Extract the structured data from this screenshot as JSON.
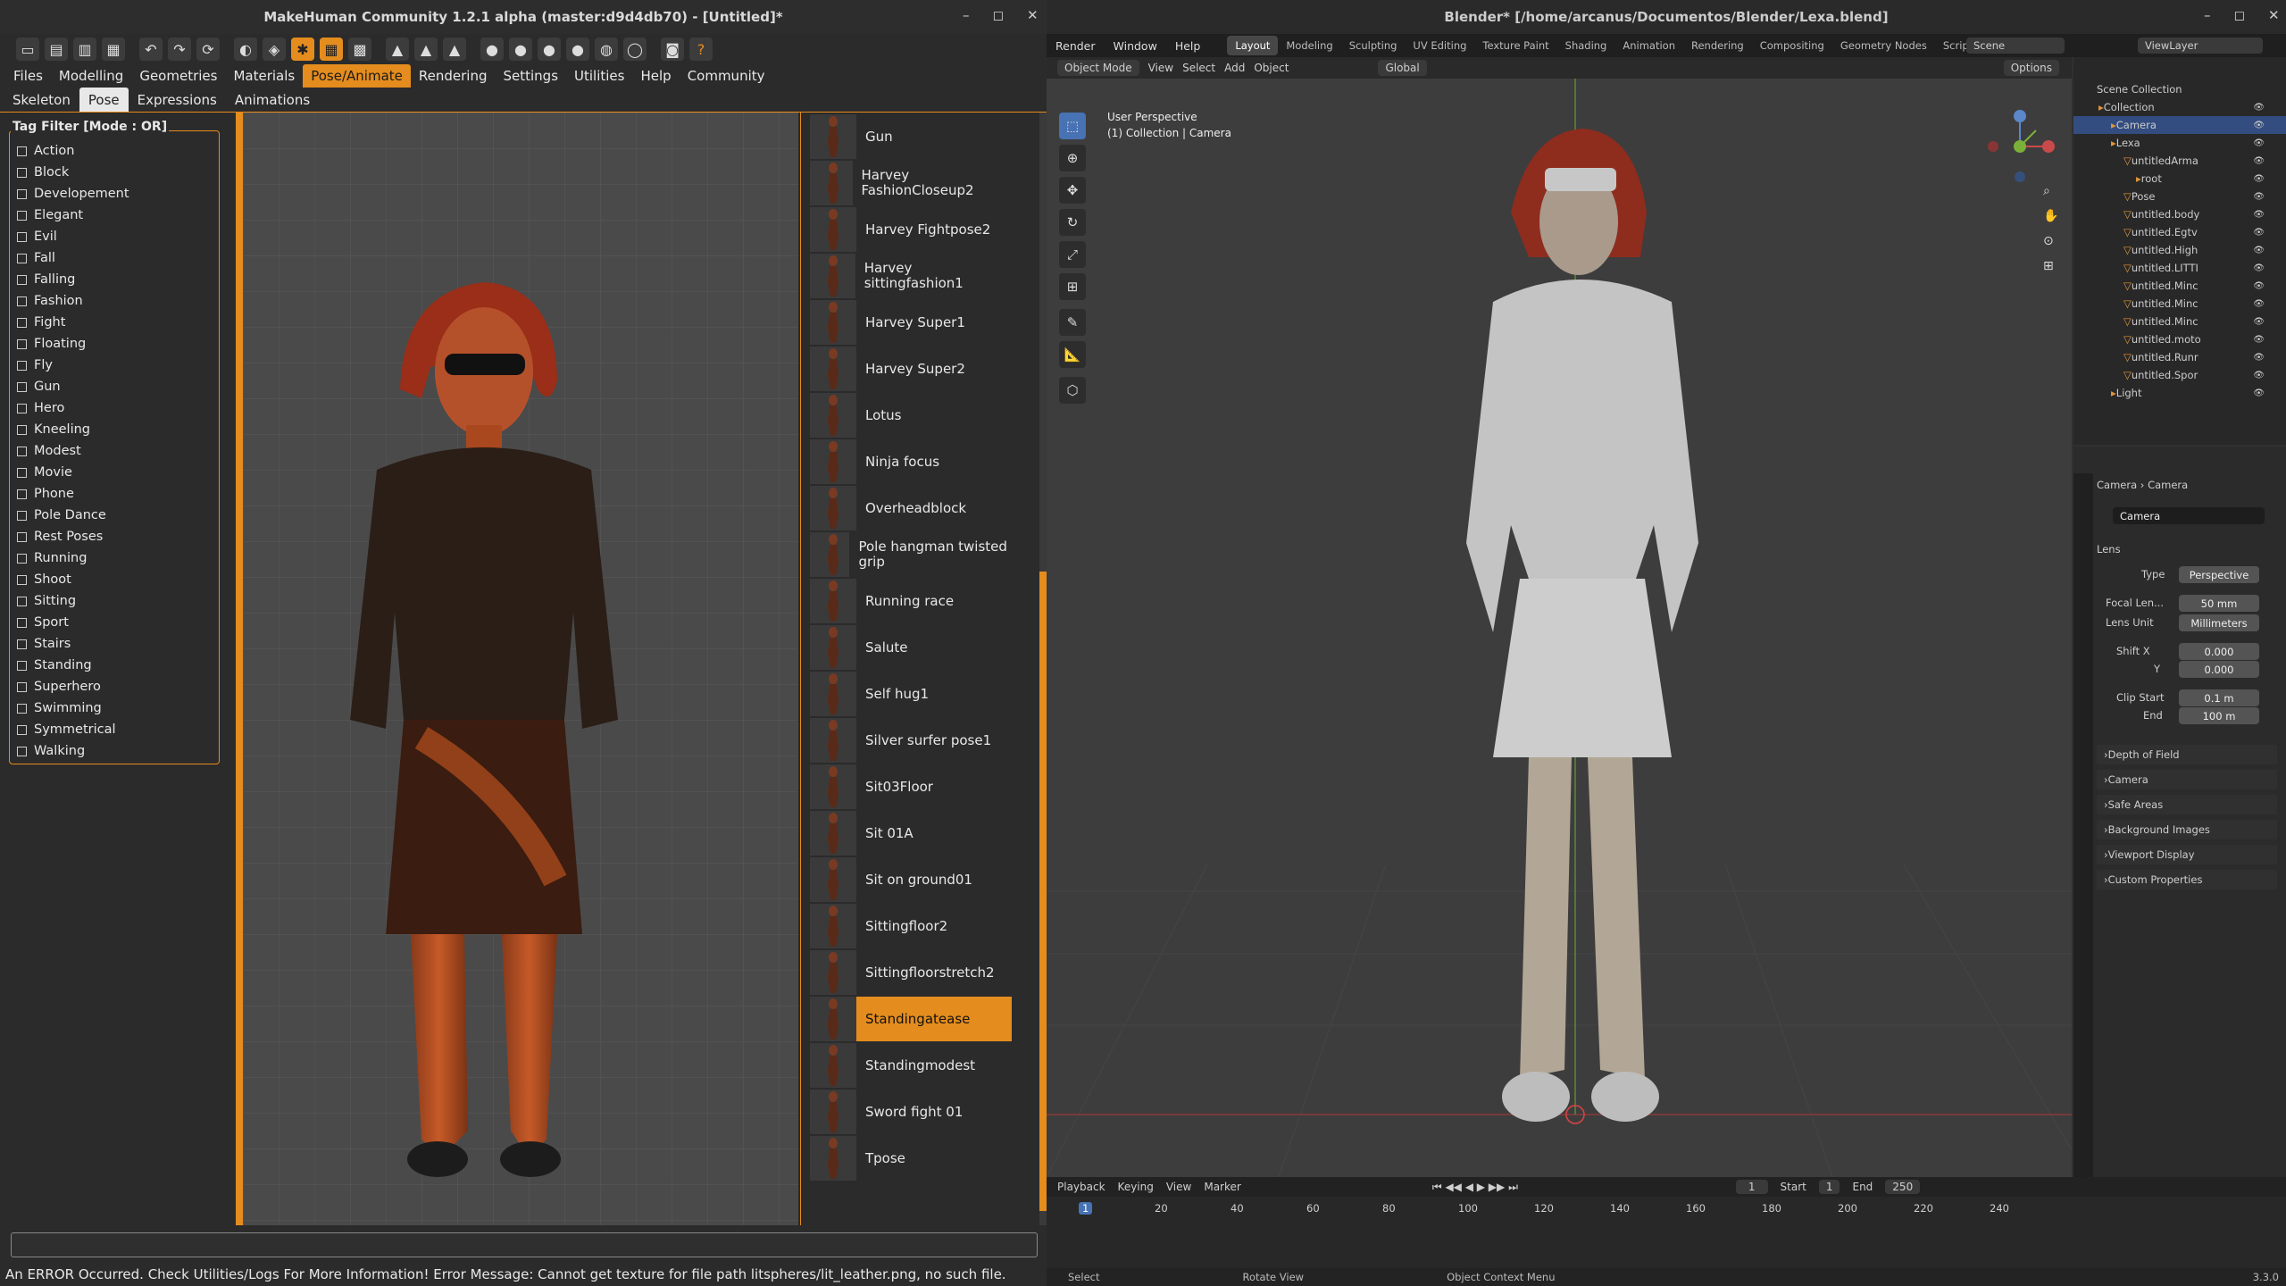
{
  "makehuman": {
    "title": "MakeHuman Community 1.2.1 alpha (master:d9d4db70) - [Untitled]*",
    "window_controls": [
      "–",
      "◻",
      "✕"
    ],
    "menu_tabs": [
      "Files",
      "Modelling",
      "Geometries",
      "Materials",
      "Pose/Animate",
      "Rendering",
      "Settings",
      "Utilities",
      "Help",
      "Community"
    ],
    "active_tab": "Pose/Animate",
    "sub_tabs": [
      "Skeleton",
      "Pose",
      "Expressions",
      "Animations"
    ],
    "active_sub_tab": "Pose",
    "tag_filter_title": "Tag Filter [Mode : OR]",
    "tags": [
      "Action",
      "Block",
      "Developement",
      "Elegant",
      "Evil",
      "Fall",
      "Falling",
      "Fashion",
      "Fight",
      "Floating",
      "Fly",
      "Gun",
      "Hero",
      "Kneeling",
      "Modest",
      "Movie",
      "Phone",
      "Pole Dance",
      "Rest Poses",
      "Running",
      "Shoot",
      "Sitting",
      "Sport",
      "Stairs",
      "Standing",
      "Superhero",
      "Swimming",
      "Symmetrical",
      "Walking"
    ],
    "poses": [
      "Gun",
      "Harvey FashionCloseup2",
      "Harvey Fightpose2",
      "Harvey sittingfashion1",
      "Harvey Super1",
      "Harvey Super2",
      "Lotus",
      "Ninja focus",
      "Overheadblock",
      "Pole hangman twisted grip",
      "Running race",
      "Salute",
      "Self hug1",
      "Silver surfer pose1",
      "Sit03Floor",
      "Sit 01A",
      "Sit on ground01",
      "Sittingfloor2",
      "Sittingfloorstretch2",
      "Standingatease",
      "Standingmodest",
      "Sword fight 01",
      "Tpose"
    ],
    "selected_pose": "Standingatease",
    "error_message": "An ERROR Occurred. Check Utilities/Logs For More Information! Error Message:  Cannot get texture for file path litspheres/lit_leather.png, no such file."
  },
  "blender": {
    "title": "Blender* [/home/arcanus/Documentos/Blender/Lexa.blend]",
    "menus": [
      "Render",
      "Window",
      "Help"
    ],
    "workspaces": [
      "Layout",
      "Modeling",
      "Sculpting",
      "UV Editing",
      "Texture Paint",
      "Shading",
      "Animation",
      "Rendering",
      "Compositing",
      "Geometry Nodes",
      "Scripting"
    ],
    "active_workspace": "Layout",
    "scene": "Scene",
    "view_layer": "ViewLayer",
    "viewport_header": {
      "mode": "Object Mode",
      "menus": [
        "View",
        "Select",
        "Add",
        "Object"
      ],
      "transform": "Global",
      "options": "Options"
    },
    "overlay": {
      "perspective": "User Perspective",
      "collection": "(1) Collection | Camera"
    },
    "outliner": {
      "root": "Scene Collection",
      "items": [
        {
          "label": "Collection",
          "level": 1
        },
        {
          "label": "Camera",
          "level": 2,
          "selected": true
        },
        {
          "label": "Lexa",
          "level": 2
        },
        {
          "label": "untitledArma",
          "level": 3
        },
        {
          "label": "root",
          "level": 4
        },
        {
          "label": "Pose",
          "level": 3
        },
        {
          "label": "untitled.body",
          "level": 3
        },
        {
          "label": "untitled.Egtv",
          "level": 3
        },
        {
          "label": "untitled.High",
          "level": 3
        },
        {
          "label": "untitled.LITTI",
          "level": 3
        },
        {
          "label": "untitled.Minc",
          "level": 3
        },
        {
          "label": "untitled.Minc",
          "level": 3
        },
        {
          "label": "untitled.Minc",
          "level": 3
        },
        {
          "label": "untitled.moto",
          "level": 3
        },
        {
          "label": "untitled.Runr",
          "level": 3
        },
        {
          "label": "untitled.Spor",
          "level": 3
        },
        {
          "label": "Light",
          "level": 2
        }
      ]
    },
    "properties": {
      "breadcrumb": [
        "Camera",
        "Camera"
      ],
      "data_name": "Camera",
      "lens_panel": "Lens",
      "type_label": "Type",
      "type_value": "Perspective",
      "focal_label": "Focal Len...",
      "focal_value": "50 mm",
      "unit_label": "Lens Unit",
      "unit_value": "Millimeters",
      "shiftx_label": "Shift X",
      "shiftx_value": "0.000",
      "shifty_label": "Y",
      "shifty_value": "0.000",
      "clip_start_label": "Clip Start",
      "clip_start_value": "0.1 m",
      "clip_end_label": "End",
      "clip_end_value": "100 m",
      "panels": [
        "Depth of Field",
        "Camera",
        "Safe Areas",
        "Background Images",
        "Viewport Display",
        "Custom Properties"
      ]
    },
    "timeline": {
      "menus": [
        "Playback",
        "Keying",
        "View",
        "Marker"
      ],
      "current_frame": "1",
      "start_label": "Start",
      "start": "1",
      "end_label": "End",
      "end": "250",
      "ticks": [
        "1",
        "20",
        "40",
        "60",
        "80",
        "100",
        "120",
        "140",
        "160",
        "180",
        "200",
        "220",
        "240"
      ]
    },
    "status": {
      "select": "Select",
      "rotate": "Rotate View",
      "context": "Object Context Menu",
      "version": "3.3.0"
    }
  }
}
